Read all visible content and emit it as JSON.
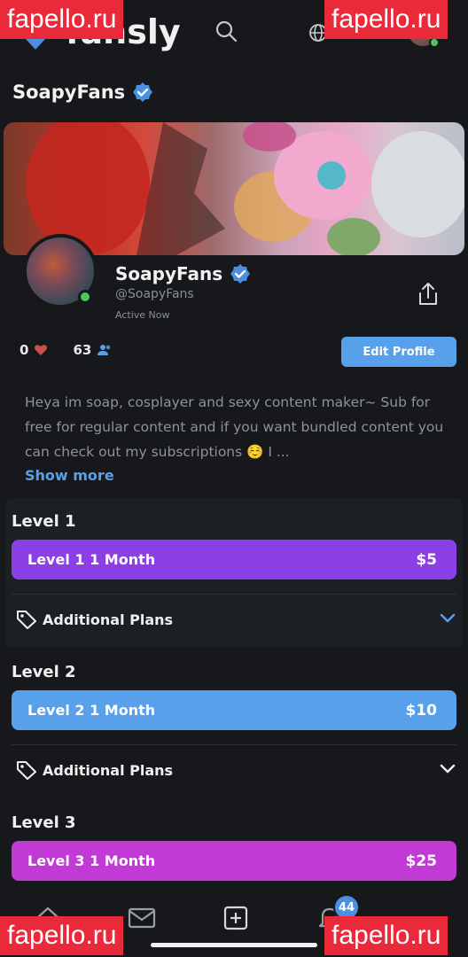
{
  "header": {
    "brand": "fansly",
    "search_icon": "search-icon",
    "globe_icon": "globe-icon"
  },
  "watermark": "fapello.ru",
  "page_title": "SoapyFans",
  "profile": {
    "display_name": "SoapyFans",
    "handle": "@SoapyFans",
    "status": "Active Now",
    "likes": "0",
    "followers": "63",
    "edit_label": "Edit Profile",
    "bio": "Heya im soap, cosplayer and sexy content maker~ Sub for free for regular content and if you want bundled content you can check out my subscriptions ☺️ I ...",
    "show_more": "Show more"
  },
  "tiers": [
    {
      "title": "Level 1",
      "plan": "Level 1 1 Month",
      "price": "$5",
      "color": "#8b3fe6",
      "additional": "Additional Plans",
      "chevron_color": "#59a0ea"
    },
    {
      "title": "Level 2",
      "plan": "Level 2 1 Month",
      "price": "$10",
      "color": "#59a0ea",
      "additional": "Additional Plans",
      "chevron_color": "#f0f0f0"
    },
    {
      "title": "Level 3",
      "plan": "Level 3 1 Month",
      "price": "$25",
      "color": "#c13ad6"
    }
  ],
  "nav": {
    "notifications_count": "44"
  },
  "colors": {
    "background": "#16181b",
    "accent": "#59a0ea",
    "verified": "#4a8fe0",
    "online": "#4fc45a"
  }
}
